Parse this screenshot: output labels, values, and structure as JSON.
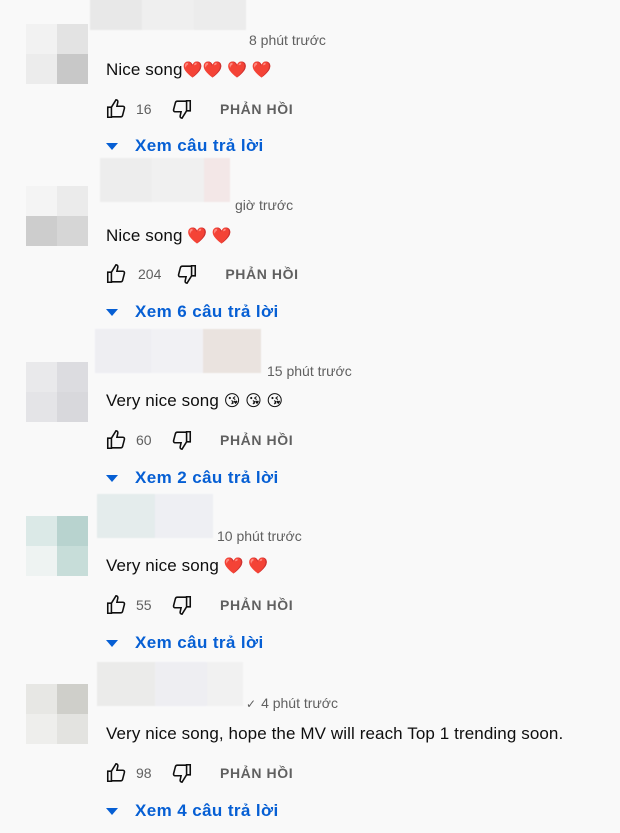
{
  "colors": {
    "link": "#065fd4",
    "secondary_text": "#606060",
    "heart": "#e3001b"
  },
  "comments": [
    {
      "time": "8 phút trước",
      "text": "Nice song",
      "emoji": "❤️❤️ ❤️ ❤️",
      "likes": "16",
      "reply_label": "PHẢN HỒI",
      "replies_label": "Xem câu trả lời",
      "verified": false
    },
    {
      "time": "giờ trước",
      "text": "Nice song",
      "emoji": "❤️ ❤️",
      "likes": "204",
      "reply_label": "PHẢN HỒI",
      "replies_label": "Xem 6 câu trả lời",
      "verified": false
    },
    {
      "time": "15 phút trước",
      "text": "Very nice song",
      "emoji": "😘 😘 😘",
      "likes": "60",
      "reply_label": "PHẢN HỒI",
      "replies_label": "Xem 2 câu trả lời",
      "verified": false
    },
    {
      "time": "10 phút trước",
      "text": "Very nice song",
      "emoji": "❤️ ❤️",
      "likes": "55",
      "reply_label": "PHẢN HỒI",
      "replies_label": "Xem câu trả lời",
      "verified": false
    },
    {
      "time": "4 phút trước",
      "text": "Very nice song, hope the MV will reach Top 1 trending soon.",
      "emoji": "",
      "likes": "98",
      "reply_label": "PHẢN HỒI",
      "replies_label": "Xem 4 câu trả lời",
      "verified": true
    }
  ]
}
